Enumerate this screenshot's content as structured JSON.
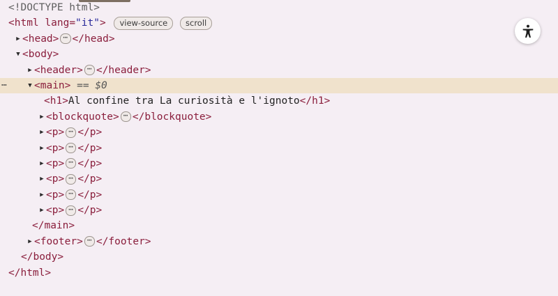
{
  "doctype": "<!DOCTYPE html>",
  "html": {
    "open": "<html",
    "attr_name": "lang",
    "attr_eq": "=",
    "attr_value": "\"it\"",
    "close_bracket": ">",
    "close": "</html>",
    "badges": [
      "view-source",
      "scroll"
    ]
  },
  "head": {
    "open": "<head>",
    "ellipsis": "⋯",
    "close": "</head>"
  },
  "body": {
    "open": "<body>",
    "close": "</body>"
  },
  "header": {
    "open": "<header>",
    "ellipsis": "⋯",
    "close": "</header>"
  },
  "main": {
    "open": "<main>",
    "selection_marker": "== $0",
    "eq": "==",
    "var": "$0",
    "gutter_dots": "⋯",
    "close": "</main>"
  },
  "h1": {
    "open": "<h1>",
    "text": "Al confine tra La curiosità e l'ignoto",
    "close": "</h1>"
  },
  "blockquote": {
    "open": "<blockquote>",
    "ellipsis": "⋯",
    "close": "</blockquote>"
  },
  "paragraphs": [
    {
      "open": "<p>",
      "ellipsis": "⋯",
      "close": "</p>"
    },
    {
      "open": "<p>",
      "ellipsis": "⋯",
      "close": "</p>"
    },
    {
      "open": "<p>",
      "ellipsis": "⋯",
      "close": "</p>"
    },
    {
      "open": "<p>",
      "ellipsis": "⋯",
      "close": "</p>"
    },
    {
      "open": "<p>",
      "ellipsis": "⋯",
      "close": "</p>"
    },
    {
      "open": "<p>",
      "ellipsis": "⋯",
      "close": "</p>"
    }
  ],
  "footer": {
    "open": "<footer>",
    "ellipsis": "⋯",
    "close": "</footer>"
  },
  "icons": {
    "collapsed": "collapsed-triangle-icon",
    "expanded": "expanded-triangle-icon",
    "accessibility": "accessibility-icon"
  },
  "colors": {
    "tag": "#8a1e3c",
    "attr_value": "#2a2a9a",
    "selected_row": "#f0e2cc",
    "background": "#f5eef4"
  }
}
